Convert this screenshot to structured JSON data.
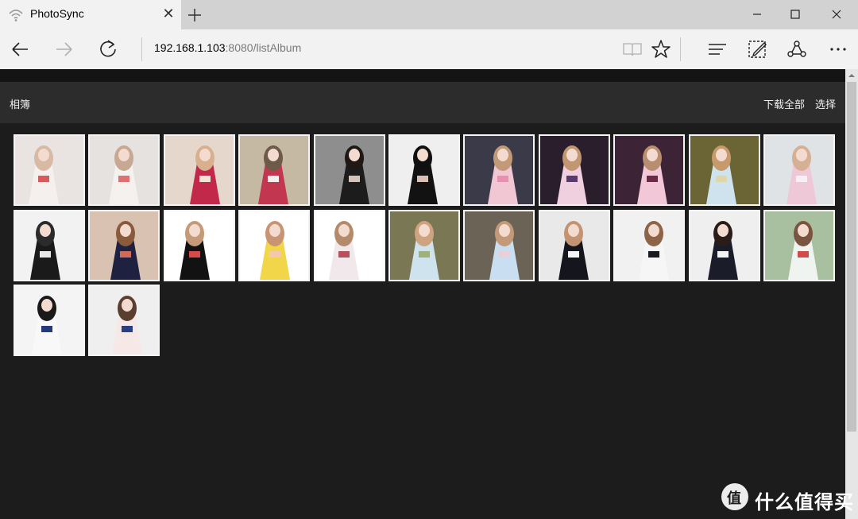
{
  "browser": {
    "tab_title": "PhotoSync",
    "tab_close_glyph": "✕",
    "address_host": "192.168.1.103",
    "address_path": ":8080/listAlbum",
    "icons": [
      "wifi-icon",
      "new-tab-icon",
      "minimize-icon",
      "maximize-icon",
      "close-icon",
      "back-icon",
      "forward-icon",
      "refresh-icon",
      "reading-view-icon",
      "favorite-star-icon",
      "hub-icon",
      "web-note-icon",
      "share-icon",
      "more-icon"
    ]
  },
  "album": {
    "title": "相簿",
    "download_all": "下载全部",
    "select": "选择"
  },
  "thumbnails": [
    {
      "name": "photo-01",
      "bg": "#e9e4e2",
      "fig": "#f4f0ee",
      "hair": "#d8b9a4",
      "accent": "#d85a5a"
    },
    {
      "name": "photo-02",
      "bg": "#e6e2e0",
      "fig": "#f5f1ef",
      "hair": "#c7a893",
      "accent": "#e07070"
    },
    {
      "name": "photo-03",
      "bg": "#e6d7cc",
      "fig": "#c2284a",
      "hair": "#d8b08d",
      "accent": "#f0e4d8"
    },
    {
      "name": "photo-04",
      "bg": "#c5b9a4",
      "fig": "#c23650",
      "hair": "#6d5a48",
      "accent": "#f4eeee"
    },
    {
      "name": "photo-05",
      "bg": "#8e8e8e",
      "fig": "#1c1c1c",
      "hair": "#201814",
      "accent": "#d4c3b8"
    },
    {
      "name": "photo-06",
      "bg": "#efefef",
      "fig": "#121212",
      "hair": "#101010",
      "accent": "#d9c0b3"
    },
    {
      "name": "photo-07",
      "bg": "#3b3a48",
      "fig": "#f1c7d3",
      "hair": "#c29a78",
      "accent": "#e98fb0"
    },
    {
      "name": "photo-08",
      "bg": "#2a1d2c",
      "fig": "#f0d0de",
      "hair": "#c19772",
      "accent": "#5a3b6e"
    },
    {
      "name": "photo-09",
      "bg": "#3c2336",
      "fig": "#f2c8d8",
      "hair": "#b98e70",
      "accent": "#6a2a4a"
    },
    {
      "name": "photo-10",
      "bg": "#6b6434",
      "fig": "#cfe3ef",
      "hair": "#c69a6b",
      "accent": "#e0d7a8"
    },
    {
      "name": "photo-11",
      "bg": "#dfe3e6",
      "fig": "#eec8d6",
      "hair": "#d6b095",
      "accent": "#f6f0f2"
    },
    {
      "name": "photo-12",
      "bg": "#f2f2f2",
      "fig": "#1a1a1a",
      "hair": "#2b2b2b",
      "accent": "#e8e8e8"
    },
    {
      "name": "photo-13",
      "bg": "#d9c2b2",
      "fig": "#1e2240",
      "hair": "#8a5a3c",
      "accent": "#d06a5a"
    },
    {
      "name": "photo-14",
      "bg": "#ffffff",
      "fig": "#121212",
      "hair": "#c49a79",
      "accent": "#d84a4a"
    },
    {
      "name": "photo-15",
      "bg": "#ffffff",
      "fig": "#f2d64a",
      "hair": "#c89474",
      "accent": "#f4c8b0"
    },
    {
      "name": "photo-16",
      "bg": "#ffffff",
      "fig": "#f0e8ea",
      "hair": "#b48a6c",
      "accent": "#b7505a"
    },
    {
      "name": "photo-17",
      "bg": "#7a7754",
      "fig": "#cfe3ee",
      "hair": "#cfa37f",
      "accent": "#9eb27a"
    },
    {
      "name": "photo-18",
      "bg": "#6a6356",
      "fig": "#c9def0",
      "hair": "#c29a77",
      "accent": "#e9d0d8"
    },
    {
      "name": "photo-19",
      "bg": "#e9e9ea",
      "fig": "#15151d",
      "hair": "#c39471",
      "accent": "#f4f4f4"
    },
    {
      "name": "photo-20",
      "bg": "#f1f1f1",
      "fig": "#f6f6f6",
      "hair": "#8e6448",
      "accent": "#1b1b22"
    },
    {
      "name": "photo-21",
      "bg": "#efefef",
      "fig": "#1b1c2a",
      "hair": "#2a1c18",
      "accent": "#f2f2f2"
    },
    {
      "name": "photo-22",
      "bg": "#a9c0a0",
      "fig": "#f0f4f0",
      "hair": "#7a5440",
      "accent": "#d34a4a"
    },
    {
      "name": "photo-23",
      "bg": "#f4f4f4",
      "fig": "#f8f8f8",
      "hair": "#1a1a1a",
      "accent": "#243a7a"
    },
    {
      "name": "photo-24",
      "bg": "#efefef",
      "fig": "#f5e8e6",
      "hair": "#5a3e30",
      "accent": "#2a3e86"
    }
  ],
  "watermark": {
    "text": "什么值得买",
    "glyph": "值"
  },
  "colors": {
    "page_bg": "#1c1c1c",
    "header_bg": "#2c2c2c",
    "tab_bg": "#f2f2f2",
    "tabstrip_bg": "#d2d2d2",
    "thumb_border": "#f5f5f5"
  }
}
